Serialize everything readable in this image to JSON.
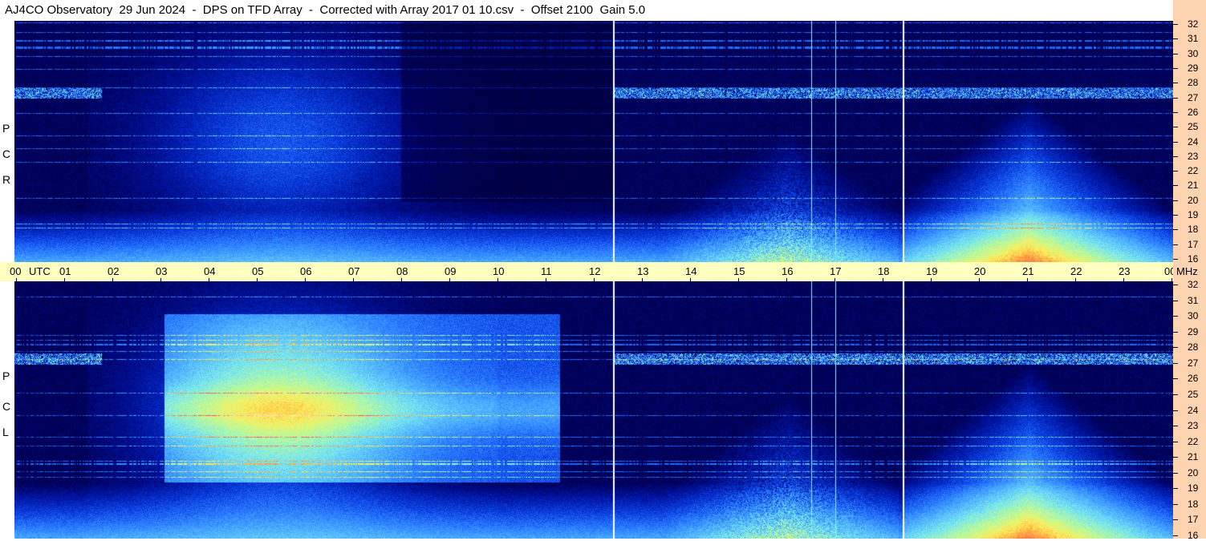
{
  "title": "AJ4CO Observatory  29 Jun 2024  -  DPS on TFD Array  -  Corrected with Array 2017 01 10.csv  -  Offset 2100  Gain 5.0",
  "polarizations": {
    "top": [
      "R",
      "C",
      "P"
    ],
    "bottom": [
      "L",
      "C",
      "P"
    ]
  },
  "time_axis": {
    "labels": [
      "00",
      "UTC",
      "01",
      "02",
      "03",
      "04",
      "05",
      "06",
      "07",
      "08",
      "09",
      "10",
      "11",
      "12",
      "13",
      "14",
      "15",
      "16",
      "17",
      "18",
      "19",
      "20",
      "21",
      "22",
      "23",
      "00",
      "MHz"
    ]
  },
  "freq_axis": {
    "labels": [
      "32",
      "31",
      "30",
      "29",
      "28",
      "27",
      "26",
      "25",
      "24",
      "23",
      "22",
      "21",
      "20",
      "19",
      "18",
      "17",
      "16"
    ]
  },
  "colors": {
    "background": "#00002a",
    "timebar": "#ffffc0",
    "freq_axis": "#fbd3b0"
  },
  "chart_data": {
    "type": "heatmap",
    "title": "AJ4CO Observatory  29 Jun 2024  -  DPS on TFD Array  -  Corrected with Array 2017 01 10.csv  -  Offset 2100  Gain 5.0",
    "xlabel": "UTC",
    "ylabel": "MHz",
    "xlim": [
      0,
      24
    ],
    "ylim": [
      16,
      32
    ],
    "panels": [
      "RCP",
      "LCP"
    ],
    "vertical_markers_utc": [
      12.4,
      16.5,
      17.0,
      18.4
    ]
  }
}
